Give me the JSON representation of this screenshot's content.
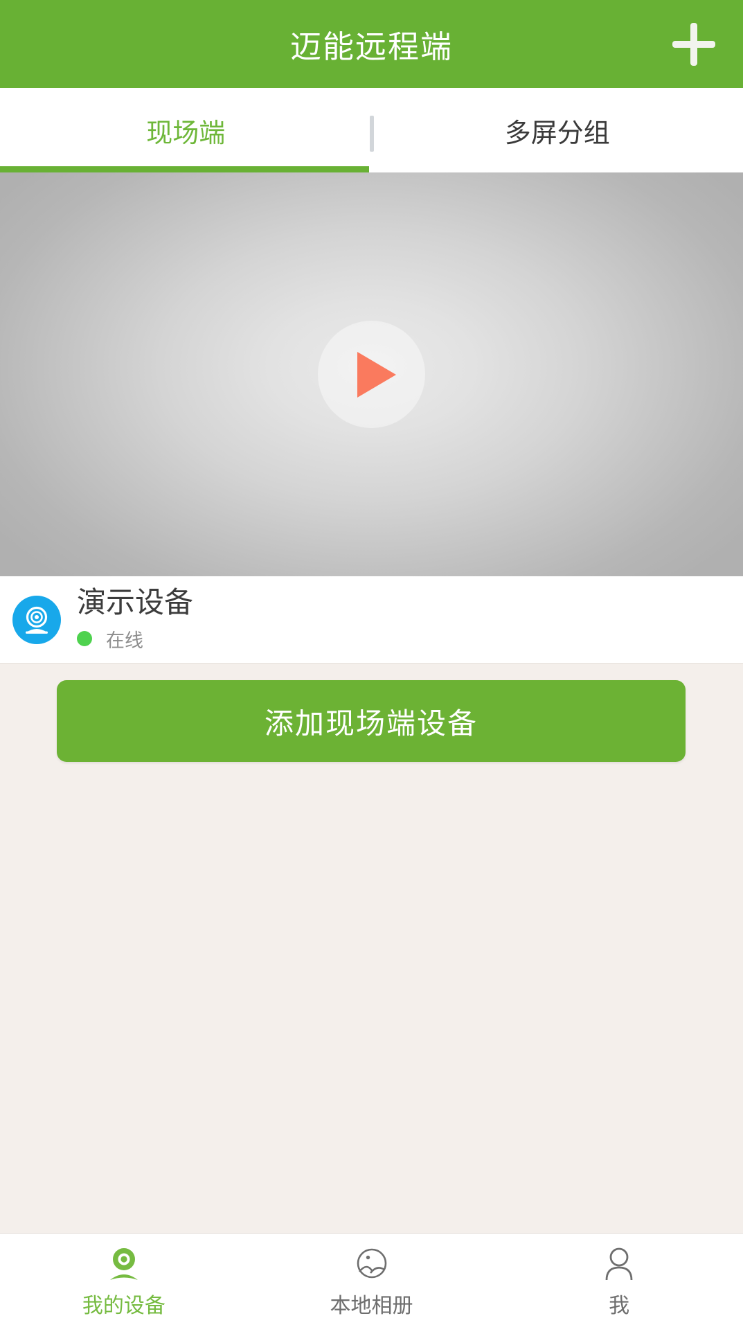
{
  "header": {
    "title": "迈能远程端",
    "add_icon": "plus-icon",
    "background_color": "#68b134",
    "text_color": "#ffffff"
  },
  "tabs": [
    {
      "label": "现场端",
      "active": true
    },
    {
      "label": "多屏分组",
      "active": false
    }
  ],
  "tabs_meta": {
    "active_color": "#6eb739",
    "inactive_color": "#3a3a3a",
    "underline_color": "#68b134"
  },
  "video": {
    "play_icon": "play-triangle-icon",
    "play_color": "#fa7a5e",
    "placeholder": true
  },
  "device": {
    "avatar_icon": "webcam-icon",
    "avatar_color": "#18a8ea",
    "name": "演示设备",
    "status": "在线",
    "status_dot_color": "#4ed24e"
  },
  "main": {
    "add_device_label": "添加现场端设备",
    "button_color": "#6cb234",
    "background_color": "#f4efeb"
  },
  "bottom_nav": [
    {
      "label": "我的设备",
      "icon": "webcam-icon",
      "active": true
    },
    {
      "label": "本地相册",
      "icon": "photo-landscape-icon",
      "active": false
    },
    {
      "label": "我",
      "icon": "person-icon",
      "active": false
    }
  ],
  "bottom_nav_meta": {
    "active_color": "#76bb41",
    "inactive_color": "#6e6e6e"
  }
}
